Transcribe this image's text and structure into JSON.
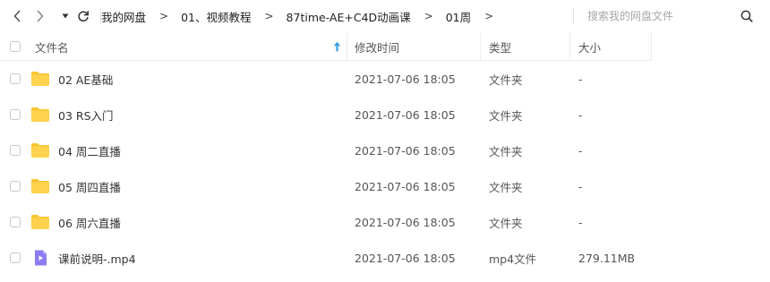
{
  "toolbar": {
    "back_icon": "chevron-left-icon",
    "forward_icon": "chevron-right-icon",
    "history_icon": "caret-down-icon",
    "refresh_icon": "refresh-icon"
  },
  "breadcrumb": [
    "我的网盘",
    "01、视频教程",
    "87time-AE+C4D动画课",
    "01周"
  ],
  "breadcrumb_separator": ">",
  "search": {
    "placeholder": "搜索我的网盘文件",
    "value": "",
    "icon": "search-icon"
  },
  "columns": {
    "name": "文件名",
    "modified": "修改时间",
    "type": "类型",
    "size": "大小"
  },
  "sort": {
    "column": "name",
    "direction": "ascending",
    "icon": "sort-arrow-up-icon",
    "color": "#3aa2e4"
  },
  "colors": {
    "folder": "#ffd24d",
    "folder_tab": "#f7c531",
    "video": "#8a7cf2"
  },
  "files": [
    {
      "icon": "folder-icon",
      "name": "02 AE基础",
      "modified": "2021-07-06 18:05",
      "type": "文件夹",
      "size": "-"
    },
    {
      "icon": "folder-icon",
      "name": "03 RS入门",
      "modified": "2021-07-06 18:05",
      "type": "文件夹",
      "size": "-"
    },
    {
      "icon": "folder-icon",
      "name": "04 周二直播",
      "modified": "2021-07-06 18:05",
      "type": "文件夹",
      "size": "-"
    },
    {
      "icon": "folder-icon",
      "name": "05 周四直播",
      "modified": "2021-07-06 18:05",
      "type": "文件夹",
      "size": "-"
    },
    {
      "icon": "folder-icon",
      "name": "06 周六直播",
      "modified": "2021-07-06 18:05",
      "type": "文件夹",
      "size": "-"
    },
    {
      "icon": "video-file-icon",
      "name": "课前说明-.mp4",
      "modified": "2021-07-06 18:05",
      "type": "mp4文件",
      "size": "279.11MB"
    }
  ]
}
